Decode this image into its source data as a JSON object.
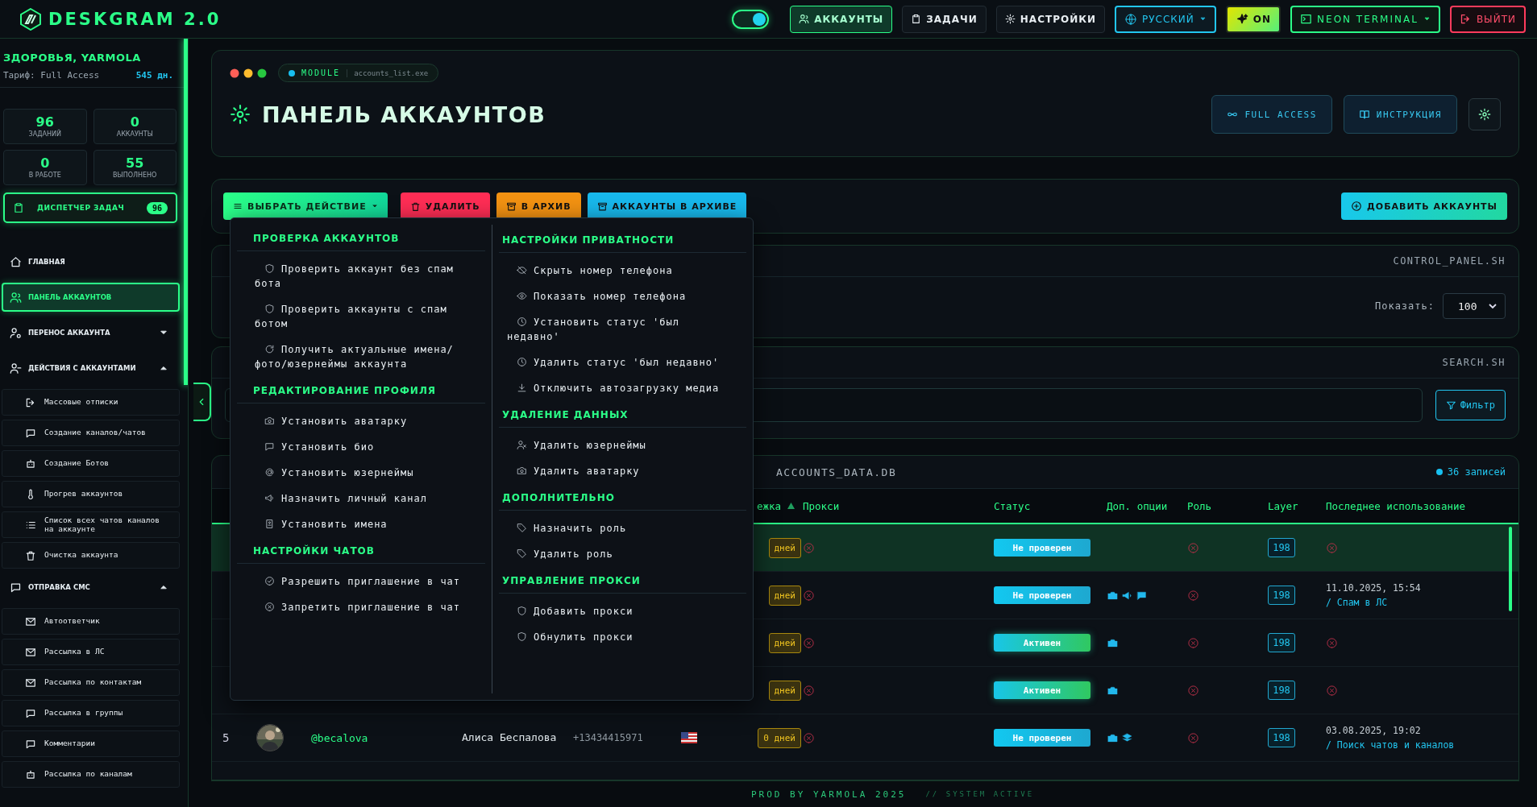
{
  "top_bar": {
    "logo": "DESKGRAM 2.0",
    "theme_toggle": {
      "on": true
    },
    "nav": [
      {
        "label": "АККАУНТЫ",
        "selected": true
      },
      {
        "label": "ЗАДАЧИ",
        "selected": false
      },
      {
        "label": "НАСТРОЙКИ",
        "selected": false
      }
    ],
    "language": "РУССКИЙ",
    "effects": {
      "label": "ON",
      "on": true
    },
    "theme": "NEON TERMINAL",
    "logout": "ВЫЙТИ"
  },
  "sidebar": {
    "greeting": "ЗДОРОВЬЯ, YARMOLA",
    "plan": "Тариф: Full Access",
    "days_left": "545 дн.",
    "stats": [
      {
        "value": "96",
        "label": "ЗАДАНИЙ"
      },
      {
        "value": "0",
        "label": "АККАУНТЫ"
      },
      {
        "value": "0",
        "label": "В РАБОТЕ"
      },
      {
        "value": "55",
        "label": "ВЫПОЛНЕНО"
      }
    ],
    "dispatcher": {
      "label": "ДИСПЕТЧЕР ЗАДАЧ",
      "count": "96"
    },
    "items": [
      {
        "kind": "link",
        "label": "ГЛАВНАЯ",
        "selected": false
      },
      {
        "kind": "link",
        "label": "ПАНЕЛЬ АККАУНТОВ",
        "selected": true
      },
      {
        "kind": "group",
        "label": "ПЕРЕНОС АККАУНТА",
        "selected": false,
        "expanded": false
      },
      {
        "kind": "group",
        "label": "ДЕЙСТВИЯ С АККАУНТАМИ",
        "selected": false,
        "expanded": true,
        "children": [
          {
            "label": "Массовые отписки",
            "selected": false
          },
          {
            "label": "Создание каналов/чатов",
            "selected": false
          },
          {
            "label": "Создание Ботов",
            "selected": false
          },
          {
            "label": "Прогрев аккаунтов",
            "selected": false
          },
          {
            "label": "Список всех чатов каналов на аккаунте",
            "selected": false
          },
          {
            "label": "Очистка аккаунта",
            "selected": false
          }
        ]
      },
      {
        "kind": "group",
        "label": "ОТПРАВКА СМС",
        "selected": false,
        "expanded": true,
        "children": [
          {
            "label": "Автоответчик",
            "selected": false
          },
          {
            "label": "Рассылка в ЛС",
            "selected": false
          },
          {
            "label": "Рассылка по контактам",
            "selected": false
          },
          {
            "label": "Рассылка в группы",
            "selected": false
          },
          {
            "label": "Комментарии",
            "selected": false
          },
          {
            "label": "Рассылка по каналам",
            "selected": false
          }
        ]
      }
    ]
  },
  "header": {
    "module": "MODULE",
    "file": "accounts_list.exe",
    "title": "ПАНЕЛЬ АККАУНТОВ",
    "access": "FULL ACCESS",
    "help": "ИНСТРУКЦИЯ"
  },
  "actions": {
    "menu_button": {
      "label": "ВЫБРАТЬ ДЕЙСТВИЕ",
      "expanded": true
    },
    "buttons": [
      {
        "kind": "delete",
        "label": "УДАЛИТЬ",
        "color": "#ff2d55"
      },
      {
        "kind": "archive",
        "label": "В АРХИВ",
        "color": "#f39212"
      },
      {
        "kind": "archived",
        "label": "АККАУНТЫ В АРХИВЕ",
        "color": "#18b8ec"
      }
    ],
    "add_button": "ДОБАВИТЬ АККАУНТЫ"
  },
  "action_menu": {
    "columns": [
      [
        {
          "title": "ПРОВЕРКА АККАУНТОВ",
          "items": [
            "Проверить аккаунт без спам бота",
            "Проверить аккаунты с спам ботом",
            "Получить актуальные имена/фото/юзернеймы аккаунта"
          ]
        },
        {
          "title": "РЕДАКТИРОВАНИЕ ПРОФИЛЯ",
          "items": [
            "Установить аватарку",
            "Установить био",
            "Установить юзернеймы",
            "Назначить личный канал",
            "Установить имена"
          ]
        },
        {
          "title": "НАСТРОЙКИ ЧАТОВ",
          "items": [
            "Разрешить приглашение в чат",
            "Запретить приглашение в чат"
          ]
        }
      ],
      [
        {
          "title": "НАСТРОЙКИ ПРИВАТНОСТИ",
          "items": [
            "Скрыть номер телефона",
            "Показать номер телефона",
            "Установить статус 'был недавно'",
            "Удалить статус 'был недавно'",
            "Отключить автозагрузку медиа"
          ]
        },
        {
          "title": "УДАЛЕНИЕ ДАННЫХ",
          "items": [
            "Удалить юзернеймы",
            "Удалить аватарку"
          ]
        },
        {
          "title": "ДОПОЛНИТЕЛЬНО",
          "items": [
            "Назначить роль",
            "Удалить роль"
          ]
        },
        {
          "title": "УПРАВЛЕНИЕ ПРОКСИ",
          "items": [
            "Добавить прокси",
            "Обнулить прокси"
          ]
        }
      ]
    ]
  },
  "control_panel": {
    "title": "CONTROL_PANEL.SH",
    "show_label": "Показать:",
    "show_value": "100"
  },
  "search": {
    "title": "SEARCH.SH",
    "filter": "Фильтр"
  },
  "table": {
    "title": "ACCOUNTS_DATA.DB",
    "count": "36 записей",
    "columns": [
      {
        "label": "ежка",
        "sorted": true
      },
      {
        "label": "Прокси",
        "sorted": false
      },
      {
        "label": "Статус",
        "sorted": false
      },
      {
        "label": "Доп. опции",
        "sorted": false
      },
      {
        "label": "Роль",
        "sorted": false
      },
      {
        "label": "Layer",
        "sorted": false
      },
      {
        "label": "Последнее использование",
        "sorted": false
      }
    ],
    "rows": [
      {
        "selected": true,
        "days": "дней",
        "proxy_set": false,
        "status": {
          "kind": "unchecked",
          "label": "Не проверен"
        },
        "role_set": false,
        "layer": "198"
      },
      {
        "selected": false,
        "days": "дней",
        "proxy_set": false,
        "status": {
          "kind": "unchecked",
          "label": "Не проверен"
        },
        "options": [
          {
            "kind": "camera"
          },
          {
            "kind": "megaphone"
          },
          {
            "kind": "chat"
          }
        ],
        "role_set": false,
        "layer": "198",
        "last_used": {
          "time": "11.10.2025, 15:54",
          "action": "/ Спам в ЛС"
        }
      },
      {
        "selected": false,
        "days": "дней",
        "proxy_set": false,
        "status": {
          "kind": "active",
          "label": "Активен"
        },
        "options": [
          {
            "kind": "camera"
          }
        ],
        "role_set": false,
        "layer": "198"
      },
      {
        "selected": false,
        "days": "дней",
        "proxy_set": false,
        "status": {
          "kind": "active",
          "label": "Активен"
        },
        "options": [
          {
            "kind": "camera"
          }
        ],
        "role_set": false,
        "layer": "198"
      },
      {
        "selected": false,
        "index": "5",
        "avatar": {
          "kind": "picture"
        },
        "username": "@becalova",
        "name": "Алиса Беспалова",
        "phone": "+13434415971",
        "days": "0 дней",
        "proxy_set": false,
        "status": {
          "kind": "unchecked",
          "label": "Не проверен"
        },
        "options": [
          {
            "kind": "camera"
          },
          {
            "kind": "layers"
          }
        ],
        "role_set": false,
        "layer": "198",
        "last_used": {
          "time": "03.08.2025, 19:02",
          "action": "/ Поиск чатов и каналов"
        }
      }
    ]
  },
  "footer": {
    "credit": "PROD BY YARMOLA 2025",
    "status": "// SYSTEM ACTIVE"
  }
}
